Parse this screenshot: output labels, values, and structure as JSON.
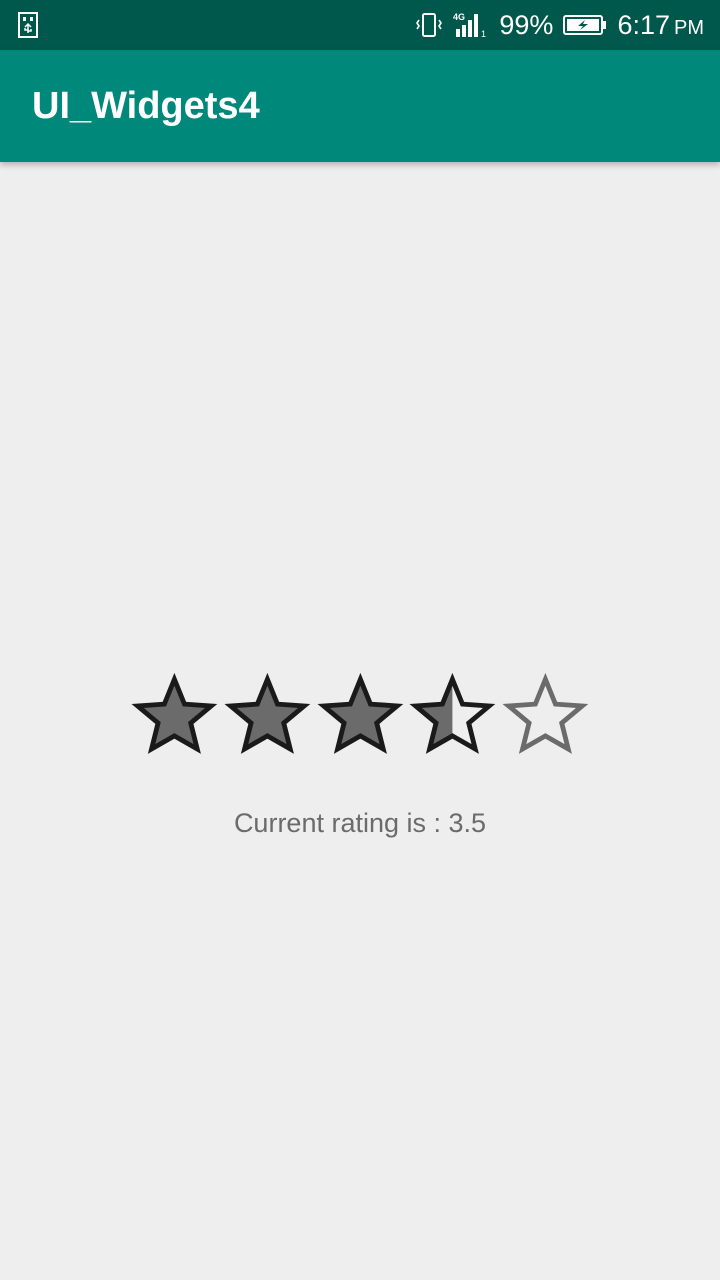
{
  "status_bar": {
    "icons": [
      "usb-icon",
      "vibrate-icon",
      "signal-4g-icon",
      "battery-charging-icon"
    ],
    "network": "4G",
    "sim_slot": "1",
    "battery": "99%",
    "time": "6:17",
    "time_suffix": "PM"
  },
  "app_bar": {
    "title": "UI_Widgets4",
    "color": "#00897b"
  },
  "rating": {
    "value": 3.5,
    "max": 5,
    "label": "Current rating is : 3.5"
  },
  "colors": {
    "status_bar": "#00574b",
    "background": "#eeeeee",
    "star_fill": "#6b6b6b",
    "star_outline": "#1a1a1a",
    "star_empty": "#6b6b6b"
  }
}
